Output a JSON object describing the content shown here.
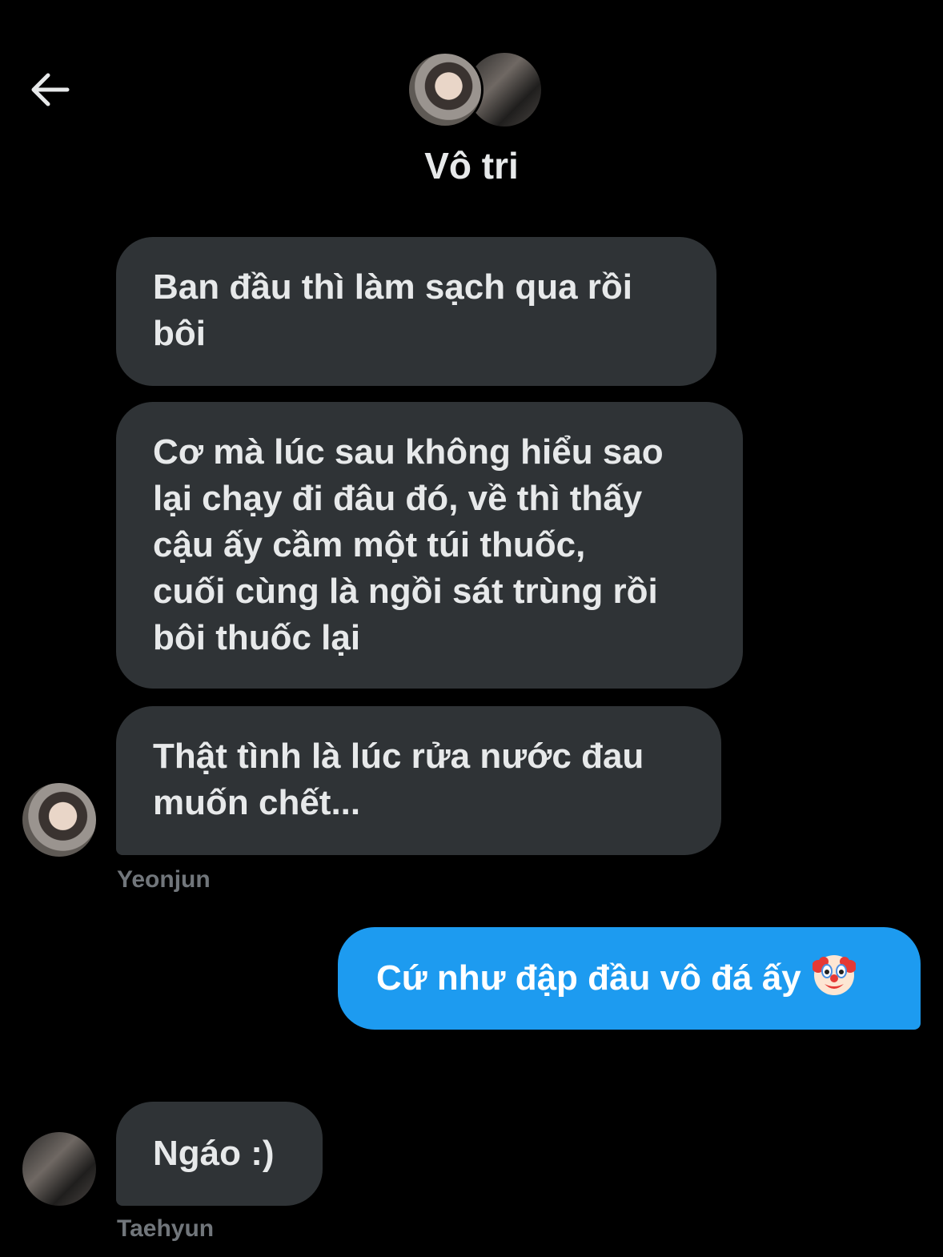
{
  "header": {
    "title": "Vô tri",
    "back_icon": "arrow-left-icon"
  },
  "messages": [
    {
      "direction": "incoming",
      "lines": [
        "Ban đầu thì làm sạch qua rồi",
        "bôi"
      ]
    },
    {
      "direction": "incoming",
      "lines": [
        "Cơ mà lúc sau không hiểu sao",
        "lại chạy đi đâu đó, về thì thấy",
        "cậu ấy cầm một túi thuốc,",
        "cuối cùng là ngồi sát trùng rồi",
        "bôi thuốc lại"
      ]
    },
    {
      "direction": "incoming",
      "lines": [
        "Thật tình là lúc rửa nước đau",
        "muốn chết..."
      ],
      "sender": "Yeonjun"
    },
    {
      "direction": "outgoing",
      "text": "Cứ như đập đầu vô đá ấy",
      "emoji": "clown-face-icon"
    },
    {
      "direction": "incoming",
      "text": "Ngáo :)",
      "sender": "Taehyun"
    }
  ],
  "colors": {
    "background": "#000000",
    "incoming_bubble": "#2f3336",
    "outgoing_bubble": "#1d9bf0",
    "sender_name": "#71767b",
    "text": "#e7e9ea"
  }
}
